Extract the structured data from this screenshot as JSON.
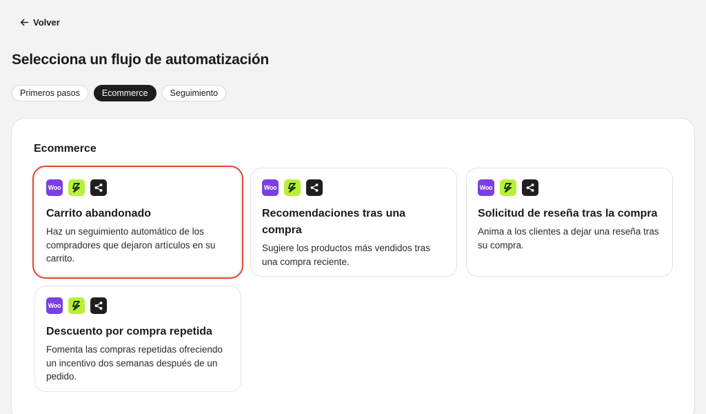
{
  "nav": {
    "back_label": "Volver"
  },
  "page": {
    "title": "Selecciona un flujo de automatización"
  },
  "tabs": [
    {
      "label": "Primeros pasos",
      "active": false
    },
    {
      "label": "Ecommerce",
      "active": true
    },
    {
      "label": "Seguimiento",
      "active": false
    }
  ],
  "section": {
    "title": "Ecommerce"
  },
  "integration_icons": {
    "woo_label": "Woo",
    "woo_color": "#7b3fe4",
    "zap_color": "#b8f03a",
    "share_color": "#1f1f1f"
  },
  "cards": [
    {
      "title": "Carrito abandonado",
      "description": "Haz un seguimiento automático de los compradores que dejaron artículos en su carrito."
    },
    {
      "title": "Recomendaciones tras una compra",
      "description": "Sugiere los productos más vendidos tras una compra reciente."
    },
    {
      "title": "Solicitud de reseña tras la compra",
      "description": "Anima a los clientes a dejar una reseña tras su compra."
    },
    {
      "title": "Descuento por compra repetida",
      "description": "Fomenta las compras repetidas ofreciendo un incentivo dos semanas después de un pedido."
    }
  ],
  "highlight_color": "#d9472b"
}
